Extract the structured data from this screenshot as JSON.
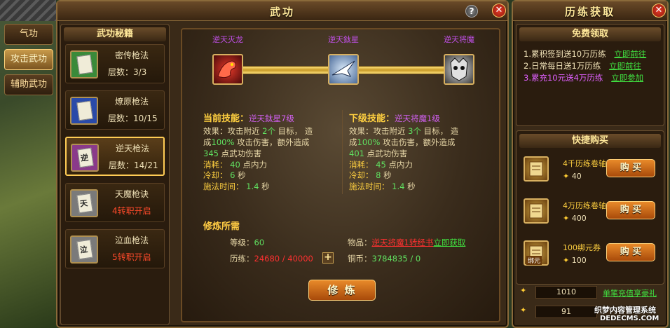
{
  "side_tabs": [
    "气功",
    "攻击武功",
    "辅助武功"
  ],
  "main": {
    "title": "武功",
    "help": "?",
    "close": "✕",
    "book_panel_title": "武功秘籍",
    "skills": [
      {
        "name": "密传枪法",
        "level": "层数：3/3",
        "lock": "",
        "glyph": "",
        "color": "#3a8a3a"
      },
      {
        "name": "燎原枪法",
        "level": "层数：10/15",
        "lock": "",
        "glyph": "",
        "color": "#2a4aa8"
      },
      {
        "name": "逆天枪法",
        "level": "层数：14/21",
        "lock": "",
        "glyph": "逆",
        "color": "#8a3a8a"
      },
      {
        "name": "天魔枪诀",
        "level": "",
        "lock": "4转职开启",
        "glyph": "天",
        "color": "#7a7a7a"
      },
      {
        "name": "泣血枪法",
        "level": "",
        "lock": "5转职开启",
        "glyph": "泣",
        "color": "#7a7a7a"
      }
    ],
    "chain": [
      {
        "title": "逆天灭龙",
        "icon": "dragon-icon"
      },
      {
        "title": "逆天鈦星",
        "icon": "star-bird-icon"
      },
      {
        "title": "逆天将魔",
        "icon": "demon-mask-icon"
      }
    ],
    "current": {
      "label": "当前技能：",
      "name": "逆天鈦星7级",
      "l1a": "效果：攻击附近",
      "l1n": "2个",
      "l1b": "目标，  造",
      "l2a": "成",
      "l2n": "100%",
      "l2b": "攻击伤害，额外造成",
      "l3n": "345",
      "l3b": "点武功伤害",
      "cost_label": "消耗：",
      "cost_val": "40",
      "cost_unit": "点内力",
      "cd_label": "冷却：",
      "cd_val": "6",
      "cd_unit": "秒",
      "cast_label": "施法时间：",
      "cast_val": "1.4",
      "cast_unit": "秒"
    },
    "next": {
      "label": "下级技能：",
      "name": "逆天将魔1级",
      "l1a": "效果：攻击附近",
      "l1n": "3个",
      "l1b": "目标，  造",
      "l2a": "成",
      "l2n": "100%",
      "l2b": "攻击伤害，额外造成",
      "l3n": "401",
      "l3b": "点武功伤害",
      "cost_label": "消耗：",
      "cost_val": "45",
      "cost_unit": "点内力",
      "cd_label": "冷却：",
      "cd_val": "8",
      "cd_unit": "秒",
      "cast_label": "施法时间：",
      "cast_val": "1.4",
      "cast_unit": "秒"
    },
    "require": {
      "title": "修炼所需",
      "level_label": "等级：",
      "level_val": "60",
      "exp_label": "历练：",
      "exp_val": "24680 / 40000",
      "plus": "+",
      "item_label": "物品：",
      "item_val": "逆天将魔1转经书",
      "item_link": "立即获取",
      "copper_label": "铜币：",
      "copper_val": "3784835 / 0"
    },
    "train_button": "修 炼"
  },
  "right": {
    "title": "历练获取",
    "close": "✕",
    "free_title": "免费领取",
    "free_rows": [
      {
        "text": "1.累积签到送10万历练",
        "link": "立即前往",
        "color": "#f0e2b8"
      },
      {
        "text": "2.日常每日送1万历练",
        "link": "立即前往",
        "color": "#f0e2b8"
      },
      {
        "text": "3.累充10元送4万历练",
        "link": "立即参加",
        "color": "#e060ff"
      }
    ],
    "shop_title": "快捷购买",
    "items": [
      {
        "name": "4千历练卷轴",
        "price": "40",
        "btn": "购 买"
      },
      {
        "name": "4万历练卷轴",
        "price": "400",
        "btn": "购 买"
      },
      {
        "name": "100绑元券",
        "price": "100",
        "btn": "购 买",
        "tag": "绑元"
      }
    ],
    "balance1": "1010",
    "balance1_link": "单笔充值享豪礼",
    "balance2": "91",
    "watermark_line1": "织梦内容管理系统",
    "watermark_line2": "DEDECMS.COM"
  }
}
